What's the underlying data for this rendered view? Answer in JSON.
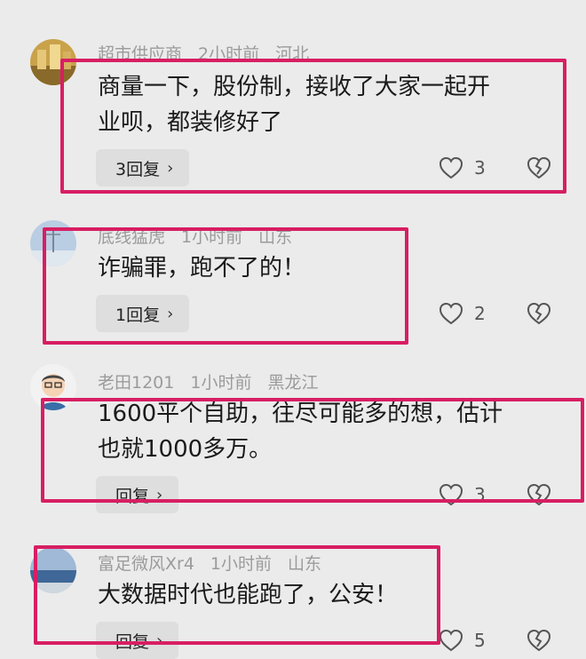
{
  "comments": [
    {
      "username": "超市供应商",
      "time": "2小时前",
      "location": "河北",
      "text_line1": "商量一下，股份制，接收了大家一起开",
      "text_line2": "业呗，都装修好了",
      "reply_label": "3回复",
      "likes": "3",
      "avatar_icon": "avatar-yellow-building"
    },
    {
      "username": "底线猛虎",
      "time": "1小时前",
      "location": "山东",
      "text_line1": "诈骗罪，跑不了的！",
      "text_line2": "",
      "reply_label": "1回复",
      "likes": "2",
      "avatar_icon": "avatar-sky"
    },
    {
      "username": "老田1201",
      "time": "1小时前",
      "location": "黑龙江",
      "text_line1": "1600平个自助，往尽可能多的想，估计",
      "text_line2": "也就1000多万。",
      "reply_label": "回复",
      "likes": "3",
      "avatar_icon": "avatar-cartoon-man"
    },
    {
      "username": "富足微风Xr4",
      "time": "1小时前",
      "location": "山东",
      "text_line1": "大数据时代也能跑了，公安！",
      "text_line2": "",
      "reply_label": "回复",
      "likes": "5",
      "avatar_icon": "avatar-sea"
    }
  ],
  "colors": {
    "highlight_frame": "#d81e63",
    "background": "#ebebeb",
    "reply_button_bg": "#dedede"
  },
  "icons": {
    "like": "heart-outline-icon",
    "dislike": "broken-heart-icon",
    "reply_chevron": "chevron-right-icon"
  }
}
